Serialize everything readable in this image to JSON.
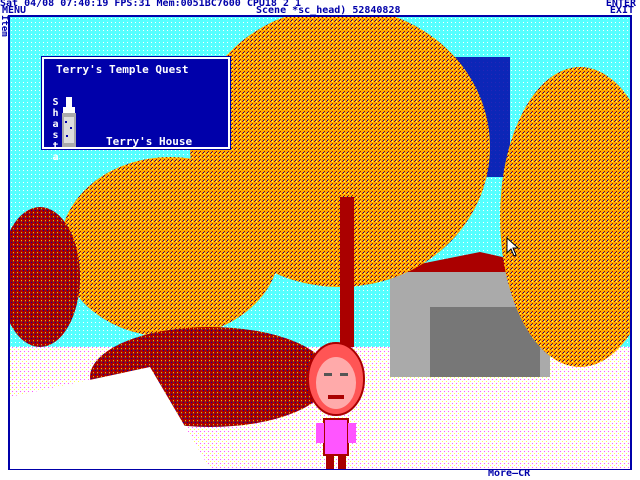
{
  "status_bar": {
    "line1": "Sat 04/08 07:40:19 FPS:31 Mem:0051BC7600 CPU18 2 1",
    "enter_label": "ENTER",
    "menu_label": "MENU",
    "scene_text": "Scene *sc_head) 52840828",
    "exit_label": "EXIT"
  },
  "side_strip": {
    "text": "Item"
  },
  "title_card": {
    "title": "Terry's Temple Quest",
    "item_name": "Shasta",
    "location": "Terry's House"
  },
  "footer": {
    "more_label": "More—CR"
  },
  "colors": {
    "ui_blue": "#0000aa",
    "sky": "#55ffff",
    "foliage_orange": "#ffaa00",
    "foliage_red": "#aa0000",
    "foliage_blue": "#0000aa",
    "white": "#ffffff"
  },
  "icons": {
    "cursor": "mouse-pointer-icon",
    "bottle": "soda-bottle-icon"
  }
}
